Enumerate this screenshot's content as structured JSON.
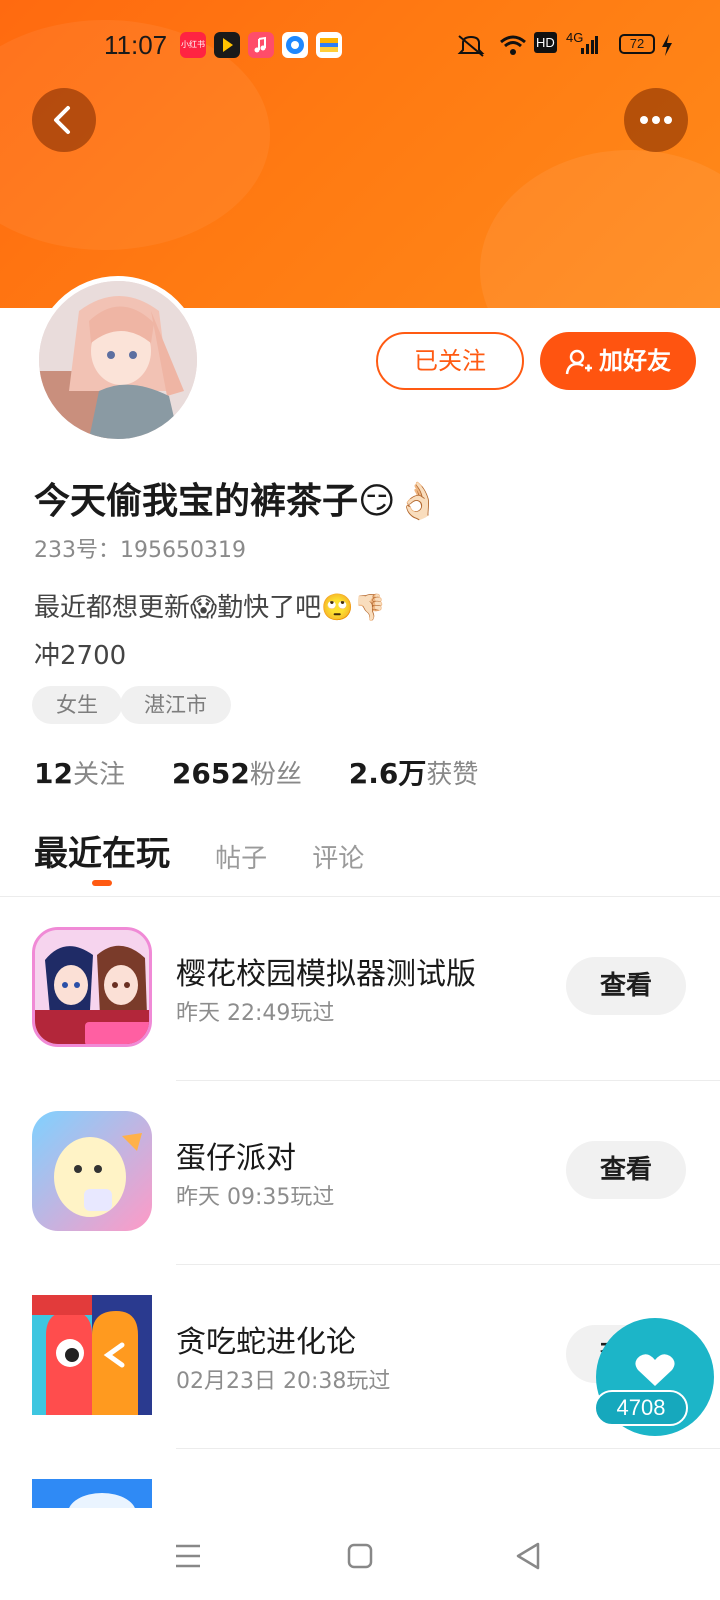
{
  "status_bar": {
    "time": "11:07",
    "apps": [
      {
        "name": "xiaohongshu-icon",
        "label": "小红书",
        "color": "#ff2442"
      },
      {
        "name": "play-app-icon",
        "label": "",
        "color": "#1a1a1a"
      },
      {
        "name": "music-app-icon",
        "label": "",
        "color": "#ff4d6a"
      },
      {
        "name": "circle-app-icon",
        "label": "",
        "color": "#1e88ff"
      },
      {
        "name": "wallet-app-icon",
        "label": "",
        "color": "#ffb300"
      }
    ],
    "network": "HD",
    "signal": "4G",
    "battery": "72"
  },
  "profile": {
    "nickname": "今天偷我宝的裤茶子😏👌🏻",
    "user_id": "233号：195650319",
    "bio": "最近都想更新😱勤快了吧🙄👎🏻\n冲2700",
    "tags": [
      "女生",
      "湛江市"
    ],
    "stats": [
      {
        "value": "12",
        "label": "关注"
      },
      {
        "value": "2652",
        "label": "粉丝"
      },
      {
        "value": "2.6万",
        "label": "获赞"
      }
    ],
    "followed_label": "已关注",
    "add_friend_label": "加好友"
  },
  "tabs": [
    "最近在玩",
    "帖子",
    "评论"
  ],
  "games": [
    {
      "name": "樱花校园模拟器测试版",
      "time": "昨天  22:49玩过",
      "action": "查看"
    },
    {
      "name": "蛋仔派对",
      "time": "昨天  09:35玩过",
      "action": "查看"
    },
    {
      "name": "贪吃蛇进化论",
      "time": "02月23日  20:38玩过",
      "action": "查看"
    }
  ],
  "like": {
    "count": "4708"
  },
  "colors": {
    "accent": "#ff5a12",
    "header": "#ff7a12",
    "like": "#1cb5c8"
  }
}
